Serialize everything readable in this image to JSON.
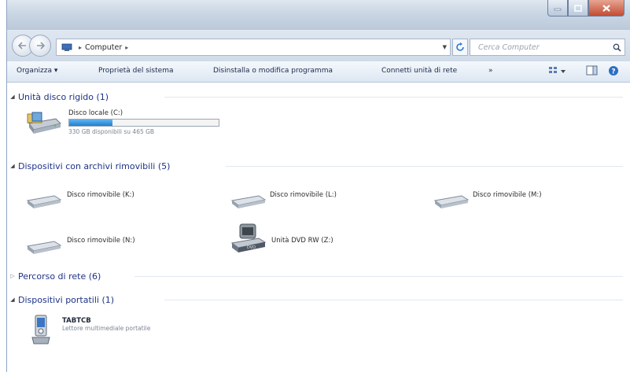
{
  "window": {
    "accent": "#1e3287",
    "close_color": "#c24c32"
  },
  "icons": {
    "back": "arrow-left-icon",
    "forward": "arrow-right-icon",
    "refresh": "refresh-icon",
    "search": "search-icon",
    "views": "view-icon",
    "preview": "preview-pane-icon",
    "help": "help-icon"
  },
  "address": {
    "path": "Computer",
    "search_placeholder": "Cerca Computer"
  },
  "toolbar": {
    "organize": "Organizza ▾",
    "system_properties": "Proprietà del sistema",
    "uninstall": "Disinstalla o modifica programma",
    "map_drive": "Connetti unità di rete",
    "more": "»"
  },
  "groups": {
    "hard_disks": {
      "title": "Unità disco rigido (1)",
      "drives": [
        {
          "label": "Disco locale (C:)",
          "free": "330 GB disponibili su 465 GB",
          "used_fraction": 0.29
        }
      ]
    },
    "removable": {
      "title": "Dispositivi con archivi rimovibili (5)",
      "drives": [
        {
          "label": "Disco rimovibile (K:)"
        },
        {
          "label": "Disco rimovibile (L:)"
        },
        {
          "label": "Disco rimovibile (M:)"
        },
        {
          "label": "Disco rimovibile (N:)"
        },
        {
          "label": "Unità DVD RW (Z:)"
        }
      ]
    },
    "network": {
      "title": "Percorso di rete (6)"
    },
    "portable": {
      "title": "Dispositivi portatili (1)",
      "devices": [
        {
          "label": "TABTCB",
          "sub": "Lettore multimediale portatile"
        }
      ]
    }
  }
}
